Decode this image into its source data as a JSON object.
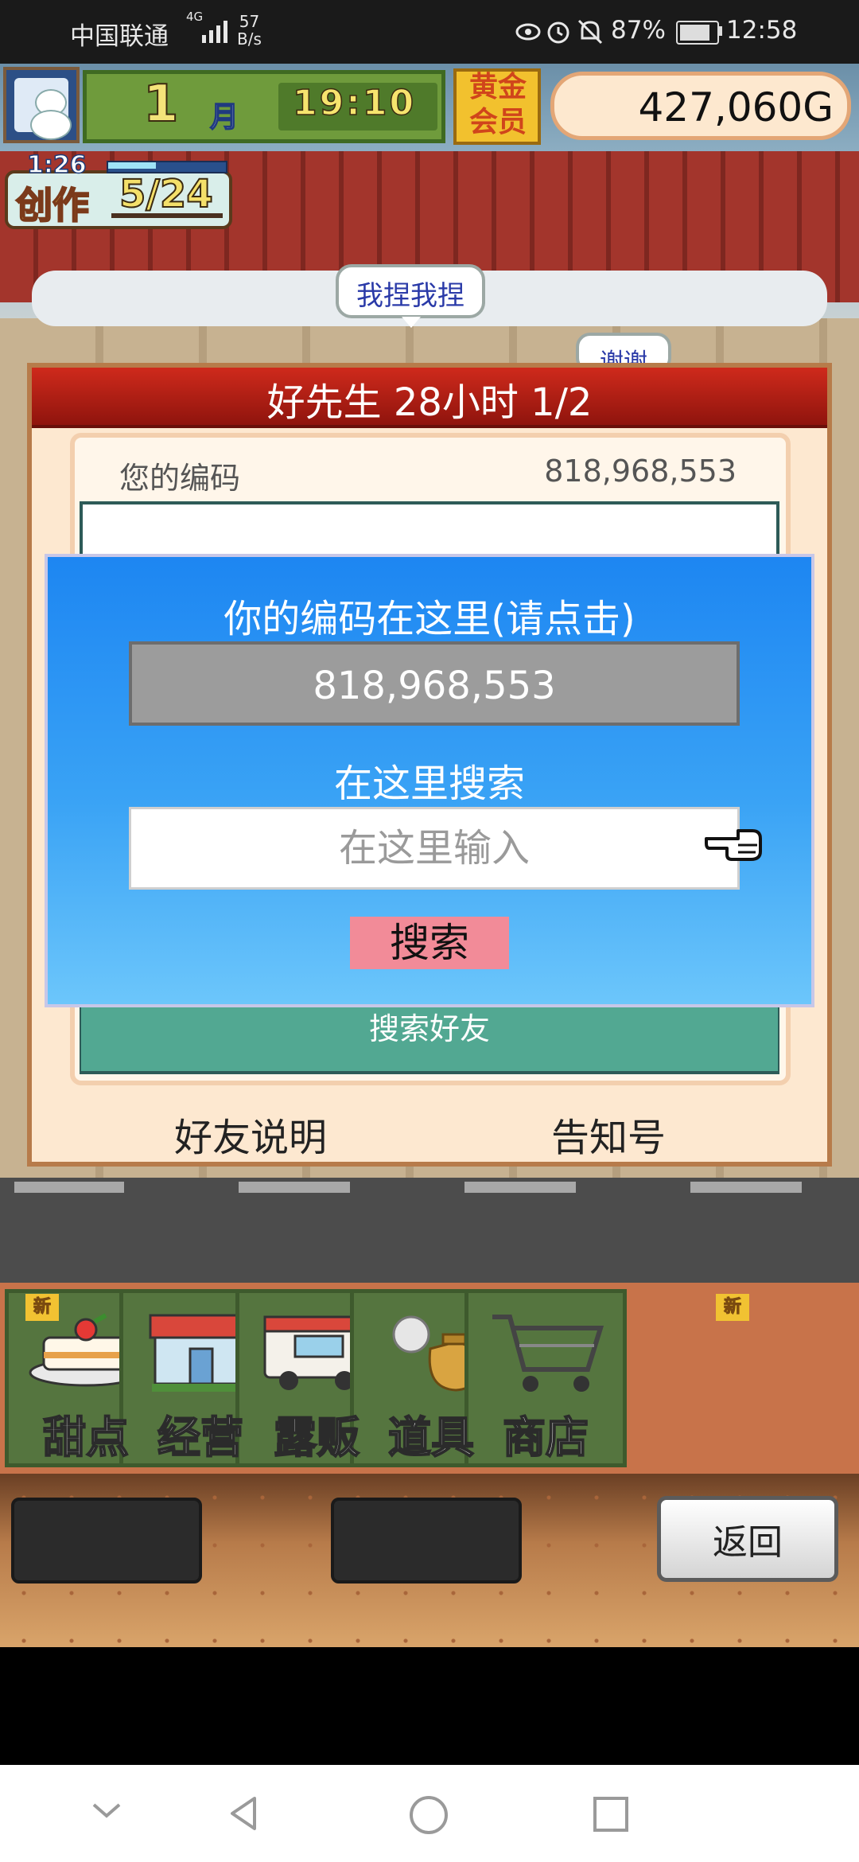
{
  "status_bar": {
    "carrier": "中国联通",
    "net_type": "4G",
    "net_speed_value": "57",
    "net_speed_unit": "B/s",
    "battery": "87%",
    "time": "12:58",
    "icons": [
      "eye-icon",
      "alarm-icon",
      "mute-icon",
      "battery-icon"
    ]
  },
  "hud": {
    "month": "1",
    "month_label": "月",
    "time": "19:10",
    "gold_member": "黄金会员",
    "money": "427,060G",
    "create_timer": "1:26",
    "create_label": "创作",
    "create_count": "5/24"
  },
  "bubbles": {
    "pinch": "我捏我捏",
    "thanks": "谢谢"
  },
  "friend_panel": {
    "title": "好先生  28小时 1/2",
    "your_code_label": "您的编码",
    "your_code_value": "818,968,553",
    "search_friend": "搜索好友",
    "footer_left": "好友说明",
    "footer_right": "告知号"
  },
  "dialog": {
    "title": "你的编码在这里(请点击)",
    "code": "818,968,553",
    "search_label": "在这里搜索",
    "search_placeholder": "在这里输入",
    "search_value": "",
    "search_button": "搜索"
  },
  "menu": {
    "items": [
      {
        "label": "甜点",
        "icon": "cake-icon",
        "new": true
      },
      {
        "label": "经营",
        "icon": "shop-icon",
        "new": false
      },
      {
        "label": "露贩",
        "icon": "food-truck-icon",
        "new": false
      },
      {
        "label": "道具",
        "icon": "items-icon",
        "new": false
      },
      {
        "label": "商店",
        "icon": "cart-icon",
        "new": true
      }
    ],
    "new_badge": "新",
    "back": "返回"
  },
  "colors": {
    "dialog_blue": "#1d86f2",
    "search_button": "#f28b98",
    "header_red": "#b21d12",
    "menu_green": "#55753f"
  }
}
